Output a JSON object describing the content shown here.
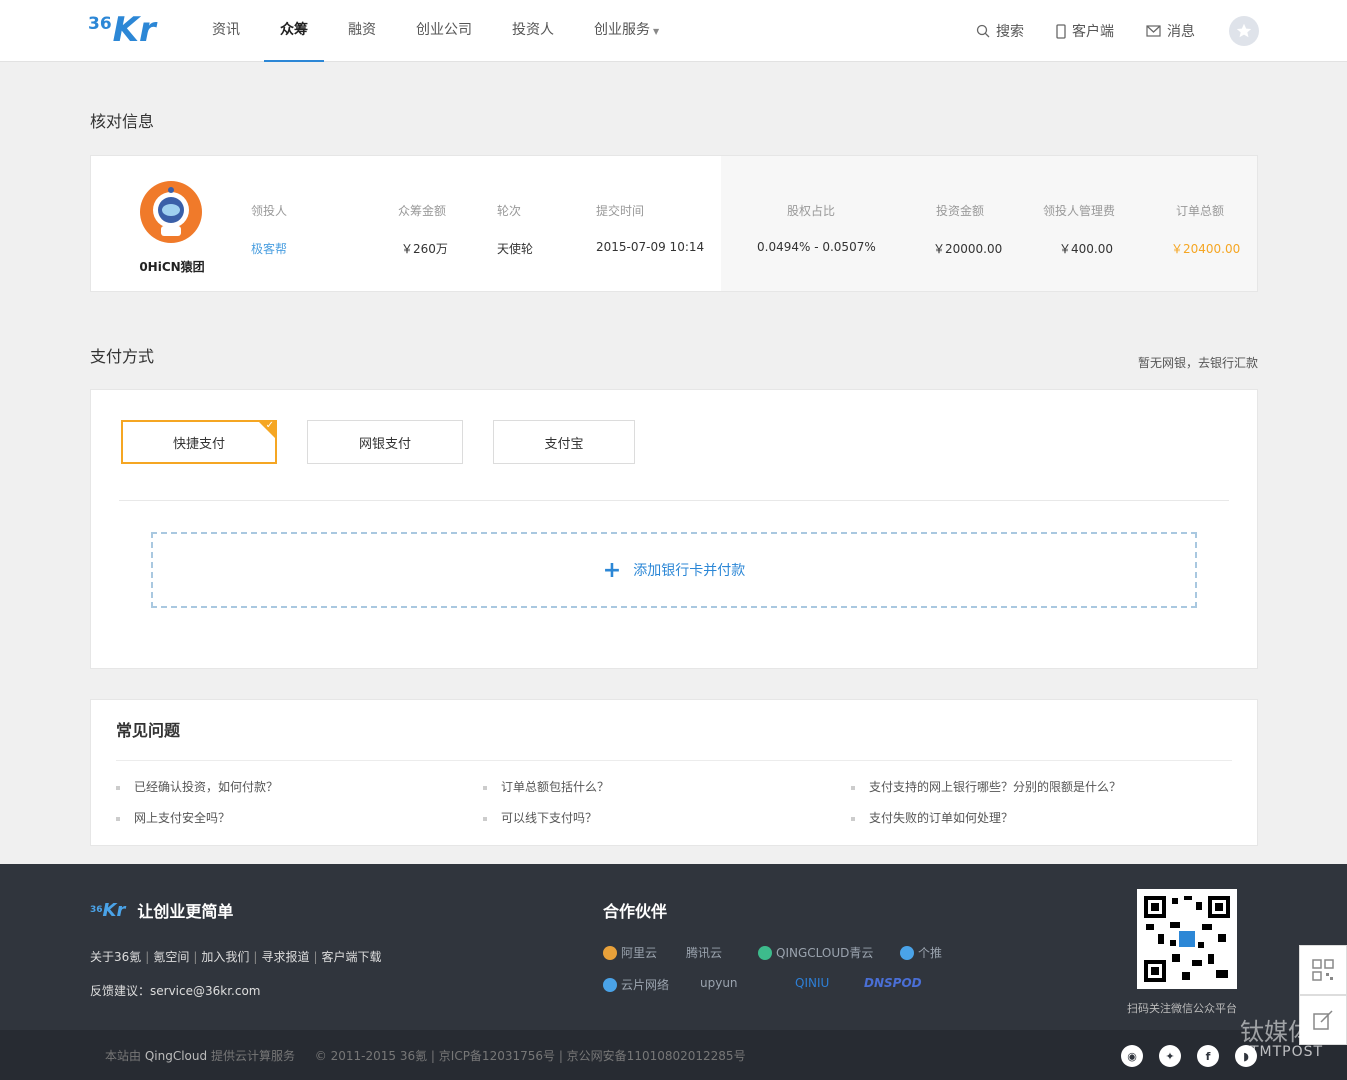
{
  "header": {
    "logo": {
      "num": "36",
      "kr": "Kr"
    },
    "nav": [
      {
        "label": "资讯"
      },
      {
        "label": "众筹"
      },
      {
        "label": "融资"
      },
      {
        "label": "创业公司"
      },
      {
        "label": "投资人"
      },
      {
        "label": "创业服务"
      }
    ],
    "active_nav": "众筹",
    "search_label": "搜索",
    "client_label": "客户端",
    "message_label": "消息"
  },
  "verify": {
    "title": "核对信息",
    "project_name": "0HiCN猿团",
    "columns": [
      {
        "header": "领投人",
        "value": "极客帮"
      },
      {
        "header": "众筹金额",
        "value": "￥260万"
      },
      {
        "header": "轮次",
        "value": "天使轮"
      },
      {
        "header": "提交时间",
        "value": "2015-07-09 10:14"
      },
      {
        "header": "股权占比",
        "value": "0.0494% - 0.0507%"
      },
      {
        "header": "投资金额",
        "value": "￥20000.00"
      },
      {
        "header": "领投人管理费",
        "value": "￥400.00"
      },
      {
        "header": "订单总额",
        "value": "￥20400.00"
      }
    ]
  },
  "payment": {
    "title": "支付方式",
    "note": "暂无网银，去银行汇款",
    "methods": [
      {
        "label": "快捷支付"
      },
      {
        "label": "网银支付"
      },
      {
        "label": "支付宝"
      }
    ],
    "selected": "快捷支付",
    "add_card_label": "添加银行卡并付款"
  },
  "faq": {
    "title": "常见问题",
    "items": [
      "已经确认投资，如何付款？",
      "订单总额包括什么？",
      "支付支持的网上银行哪些？分别的限额是什么？",
      "网上支付安全吗？",
      "可以线下支付吗？",
      "支付失败的订单如何处理？"
    ]
  },
  "footer": {
    "logo": {
      "num": "36",
      "kr": "Kr"
    },
    "slogan": "让创业更简单",
    "links": [
      "关于36氪",
      "氪空间",
      "加入我们",
      "寻求报道",
      "客户端下载"
    ],
    "feedback_label": "反馈建议：",
    "feedback_email": "service@36kr.com",
    "partners_title": "合作伙伴",
    "partners": [
      {
        "name": "阿里云",
        "color": "#e8a13a"
      },
      {
        "name": "腾讯云",
        "color": "#8aa0b8"
      },
      {
        "name": "QINGCLOUD青云",
        "color": "#3dbb8c"
      },
      {
        "name": "个推",
        "color": "#4aa3e8"
      },
      {
        "name": "云片网络",
        "color": "#4aa3e8"
      },
      {
        "name": "upyun",
        "color": "#8aa0b8"
      },
      {
        "name": "QINIU",
        "color": "#2d7fd6"
      },
      {
        "name": "DNSPOD",
        "color": "#4a6fd6"
      }
    ],
    "qr_caption": "扫码关注微信公众平台",
    "bottom_prefix": "本站由",
    "bottom_qc": "QingCloud",
    "bottom_suffix": "提供云计算服务",
    "copyright": "© 2011-2015 36氪 | 京ICP备12031756号 | 京公网安备11010802012285号"
  },
  "watermark": {
    "cn": "钛媒体",
    "en": "TMTPOST"
  },
  "colors": {
    "brand": "#2c87d6",
    "accent": "#f5a623",
    "footer": "#30353d"
  }
}
